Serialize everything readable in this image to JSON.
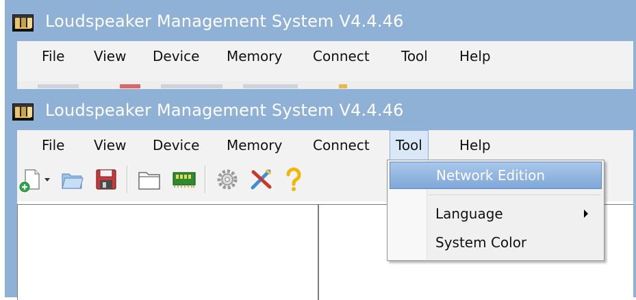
{
  "app": {
    "title": "Loudspeaker Management System V4.4.46"
  },
  "menubar": {
    "items": [
      {
        "label": "File"
      },
      {
        "label": "View"
      },
      {
        "label": "Device"
      },
      {
        "label": "Memory"
      },
      {
        "label": "Connect"
      },
      {
        "label": "Tool"
      },
      {
        "label": "Help"
      }
    ]
  },
  "tool_menu": {
    "items": [
      {
        "label": "Network Edition"
      },
      {
        "label": "Language"
      },
      {
        "label": "System Color"
      }
    ]
  },
  "icons": {
    "app": "app-logo-icon",
    "new": "new-file-icon",
    "new_dropdown": "chevron-down-icon",
    "open": "folder-open-icon",
    "save": "save-disk-icon",
    "folder": "folder-icon",
    "device": "device-module-icon",
    "settings": "gear-icon",
    "tools": "tools-icon",
    "help": "help-question-icon",
    "submenu": "chevron-right-icon"
  },
  "colors": {
    "titlebar": "#8fb1d6",
    "menu_hover": "#7fa7d8",
    "menubar": "#f2f2f2"
  }
}
